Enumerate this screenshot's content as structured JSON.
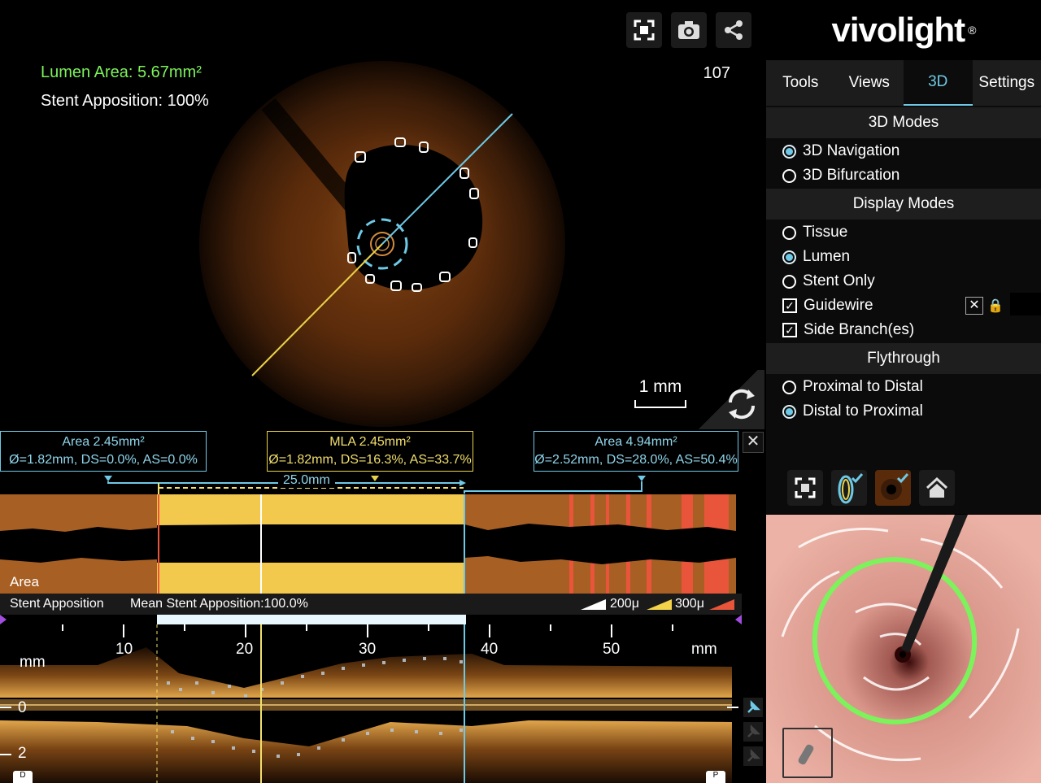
{
  "viewer": {
    "lumen_area": "Lumen Area: 5.67mm²",
    "stent_apposition": "Stent Apposition: 100%",
    "frame_number": "107",
    "scale_label": "1 mm",
    "buttons": [
      "fullscreen-icon",
      "camera-icon",
      "share-icon"
    ]
  },
  "logo": {
    "text": "vivolight",
    "mark": "®"
  },
  "tabs": [
    {
      "label": "Tools",
      "active": false
    },
    {
      "label": "Views",
      "active": false
    },
    {
      "label": "3D",
      "active": true
    },
    {
      "label": "Settings",
      "active": false
    }
  ],
  "modes_3d": {
    "heading": "3D Modes",
    "options": [
      {
        "label": "3D Navigation",
        "selected": true
      },
      {
        "label": "3D Bifurcation",
        "selected": false
      }
    ]
  },
  "display_modes": {
    "heading": "Display Modes",
    "radios": [
      {
        "label": "Tissue",
        "selected": false
      },
      {
        "label": "Lumen",
        "selected": true
      },
      {
        "label": "Stent Only",
        "selected": false
      }
    ],
    "checks": [
      {
        "label": "Guidewire",
        "checked": true
      },
      {
        "label": "Side Branch(es)",
        "checked": true
      }
    ]
  },
  "flythrough": {
    "heading": "Flythrough",
    "options": [
      {
        "label": "Proximal to Distal",
        "selected": false
      },
      {
        "label": "Distal to Proximal",
        "selected": true
      }
    ]
  },
  "measurements": {
    "left": {
      "line1": "Area 2.45mm²",
      "line2": "Ø=1.82mm, DS=0.0%, AS=0.0%"
    },
    "mla": {
      "line1": "MLA 2.45mm²",
      "line2": "Ø=1.82mm, DS=16.3%, AS=33.7%"
    },
    "right": {
      "line1": "Area 4.94mm²",
      "line2": "Ø=2.52mm, DS=28.0%, AS=50.4%"
    },
    "length": "25.0mm"
  },
  "area_strip": {
    "label": "Area"
  },
  "apposition": {
    "title": "Stent Apposition",
    "mean": "Mean Stent Apposition:100.0%",
    "legend": [
      {
        "label": "200μ",
        "color": "#ffffff"
      },
      {
        "label": "300μ",
        "color": "#f2d34a"
      },
      {
        "label": "",
        "color": "#e8553a"
      }
    ]
  },
  "longitudinal": {
    "ticks": [
      "10",
      "20",
      "30",
      "40",
      "50"
    ],
    "unit_left": "mm",
    "unit_right": "mm",
    "depth_labels": [
      "0",
      "2"
    ],
    "end_left": "D",
    "end_right": "P"
  },
  "colors": {
    "accent": "#6ec9e6",
    "mla": "#e9d24a",
    "lumen_green": "#7cf25b",
    "stent_region": "#f2c94c",
    "vessel_brown": "#a85f23",
    "warning": "#e8553a"
  }
}
